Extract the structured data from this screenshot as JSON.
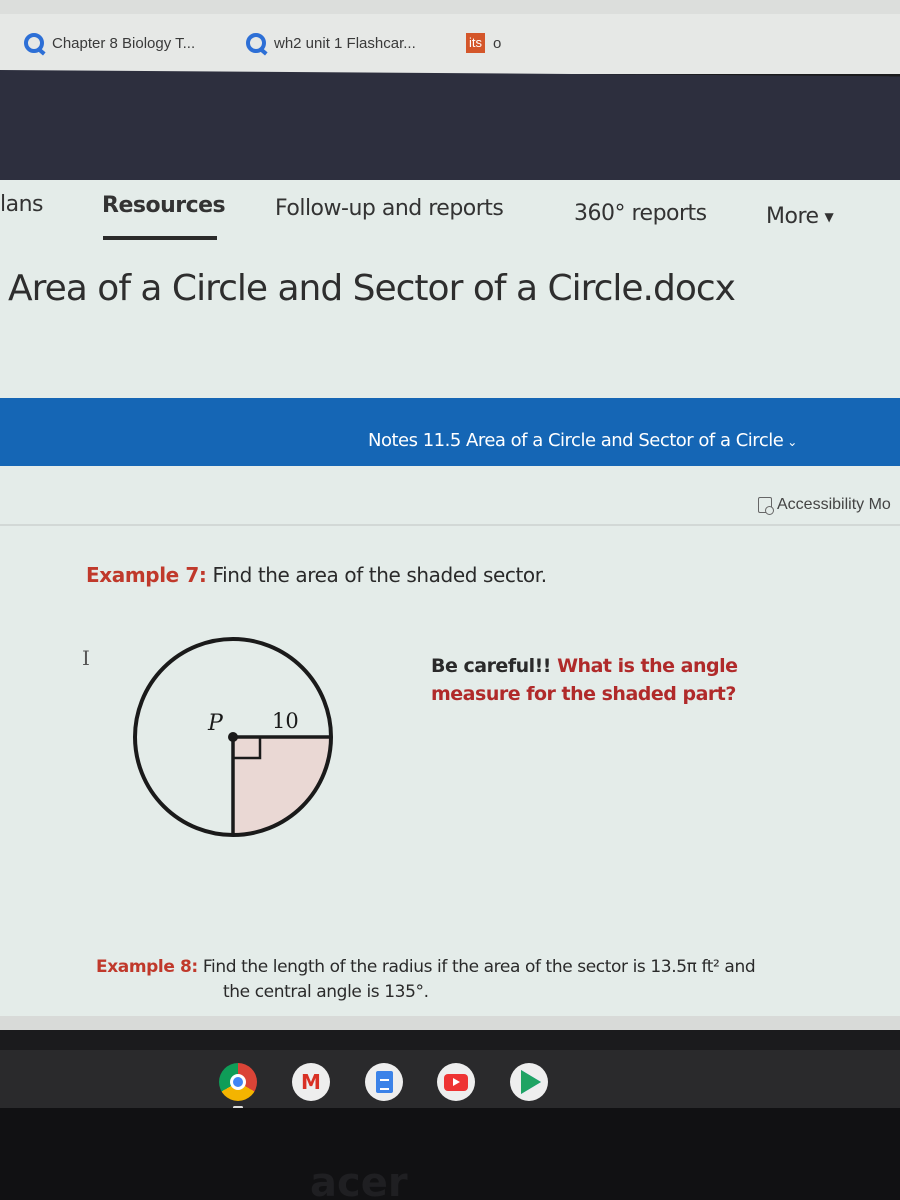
{
  "bookmarks": [
    {
      "icon": "quizlet-icon",
      "label": "Chapter 8 Biology T..."
    },
    {
      "icon": "quizlet-icon",
      "label": "wh2 unit 1 Flashcar..."
    },
    {
      "icon": "its-icon",
      "icon_text": "its",
      "label": "o"
    }
  ],
  "nav": {
    "tabs": [
      {
        "label": "lans",
        "active": false
      },
      {
        "label": "Resources",
        "active": true
      },
      {
        "label": "Follow-up and reports",
        "active": false
      },
      {
        "label": "360° reports",
        "active": false
      },
      {
        "label": "More",
        "active": false
      }
    ],
    "more_arrow": "▼"
  },
  "document": {
    "title": "Area of a Circle and Sector of a Circle.docx",
    "viewer_title": "Notes 11.5 Area of a Circle and Sector of a Circle",
    "viewer_chevron": "⌄",
    "accessibility_label": "Accessibility Mo"
  },
  "content": {
    "example7": {
      "label": "Example 7:",
      "text": "Find the area of the shaded sector."
    },
    "diagram": {
      "center_label": "P",
      "radius_label": "10",
      "shaded_fill": "#ead8d4"
    },
    "careful": {
      "prefix": "Be careful!!",
      "question_line1": "What is the angle",
      "question_line2": "measure for the shaded part?"
    },
    "example8": {
      "label": "Example 8:",
      "line1": "Find the length of the radius if the area of the sector is 13.5π  ft² and",
      "line2": "the central angle is 135°."
    },
    "cursor_glyph": "I"
  },
  "shelf": {
    "apps": [
      {
        "name": "Chrome"
      },
      {
        "name": "Gmail",
        "glyph": "M"
      },
      {
        "name": "Docs"
      },
      {
        "name": "YouTube"
      },
      {
        "name": "Play Store"
      }
    ]
  },
  "device": {
    "brand": "acer"
  },
  "colors": {
    "accent_blue": "#1566b5",
    "example_red": "#c0392b",
    "question_red": "#b02a2a"
  }
}
